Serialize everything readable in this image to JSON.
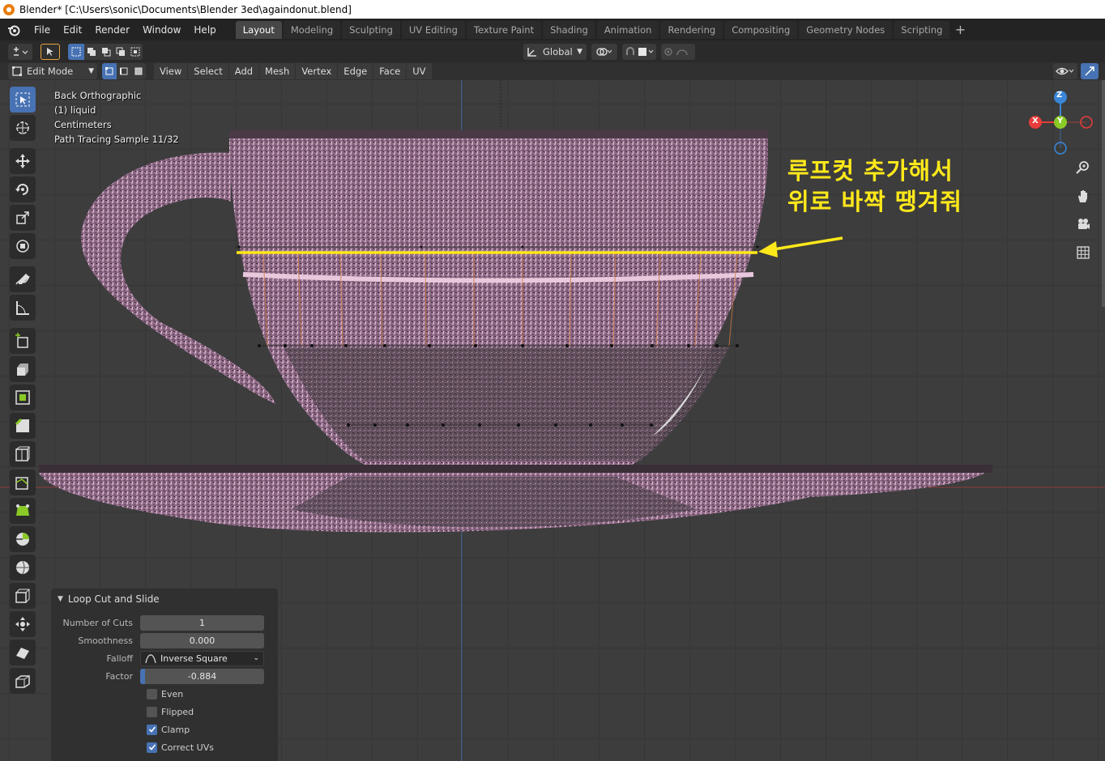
{
  "window": {
    "title": "Blender* [C:\\Users\\sonic\\Documents\\Blender 3ed\\againdonut.blend]"
  },
  "menu": [
    "File",
    "Edit",
    "Render",
    "Window",
    "Help"
  ],
  "workspaces": [
    "Layout",
    "Modeling",
    "Sculpting",
    "UV Editing",
    "Texture Paint",
    "Shading",
    "Animation",
    "Rendering",
    "Compositing",
    "Geometry Nodes",
    "Scripting"
  ],
  "active_workspace": "Layout",
  "header": {
    "transform_orientation": "Global",
    "mode": "Edit Mode",
    "view_menus": [
      "View",
      "Select",
      "Add",
      "Mesh",
      "Vertex",
      "Edge",
      "Face",
      "UV"
    ]
  },
  "viewport_info": {
    "lines": [
      "Back Orthographic",
      "(1) liquid",
      "Centimeters",
      "Path Tracing Sample 11/32"
    ]
  },
  "gizmo": {
    "z": "Z",
    "y": "Y",
    "x": "X"
  },
  "annotation": {
    "line1": "루프컷 추가해서",
    "line2": "위로 바짝 땡겨줘",
    "color": "#ffe81a"
  },
  "operator_panel": {
    "title": "Loop Cut and Slide",
    "number_of_cuts_label": "Number of Cuts",
    "number_of_cuts": "1",
    "smoothness_label": "Smoothness",
    "smoothness": "0.000",
    "falloff_label": "Falloff",
    "falloff": "Inverse Square",
    "factor_label": "Factor",
    "factor": "-0.884",
    "even_label": "Even",
    "even": false,
    "flipped_label": "Flipped",
    "flipped": false,
    "clamp_label": "Clamp",
    "clamp": true,
    "correct_uvs_label": "Correct UVs",
    "correct_uvs": true
  },
  "colors": {
    "accent": "#4772b3",
    "highlight_line": "#ffe81a",
    "axis_x": "#e83c3c",
    "axis_y": "#8ac926",
    "axis_z": "#3a86d8"
  }
}
